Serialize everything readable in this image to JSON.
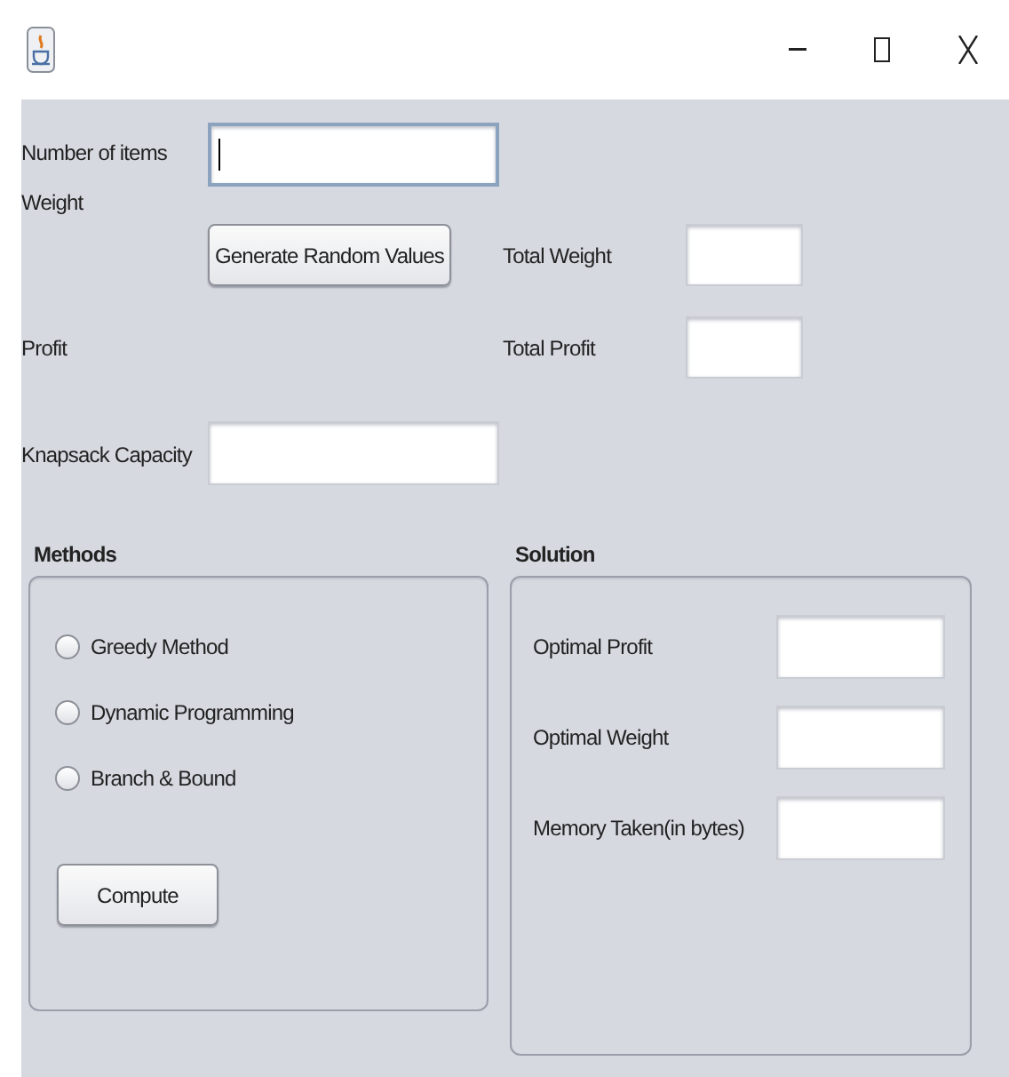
{
  "form": {
    "number_of_items": {
      "label": "Number of items",
      "focused": true
    },
    "weight_label": "Weight",
    "generate_button": "Generate Random Values",
    "total_weight": {
      "label": "Total Weight"
    },
    "profit_label": "Profit",
    "total_profit": {
      "label": "Total Profit"
    },
    "knapsack_capacity": {
      "label": "Knapsack Capacity"
    }
  },
  "methods": {
    "title": "Methods",
    "options": [
      {
        "label": "Greedy Method",
        "selected": false
      },
      {
        "label": "Dynamic Programming",
        "selected": false
      },
      {
        "label": "Branch & Bound",
        "selected": false
      }
    ],
    "compute_button": "Compute"
  },
  "solution": {
    "title": "Solution",
    "fields": [
      {
        "label": "Optimal Profit"
      },
      {
        "label": "Optimal Weight"
      },
      {
        "label": "Memory Taken(in bytes)"
      }
    ]
  }
}
